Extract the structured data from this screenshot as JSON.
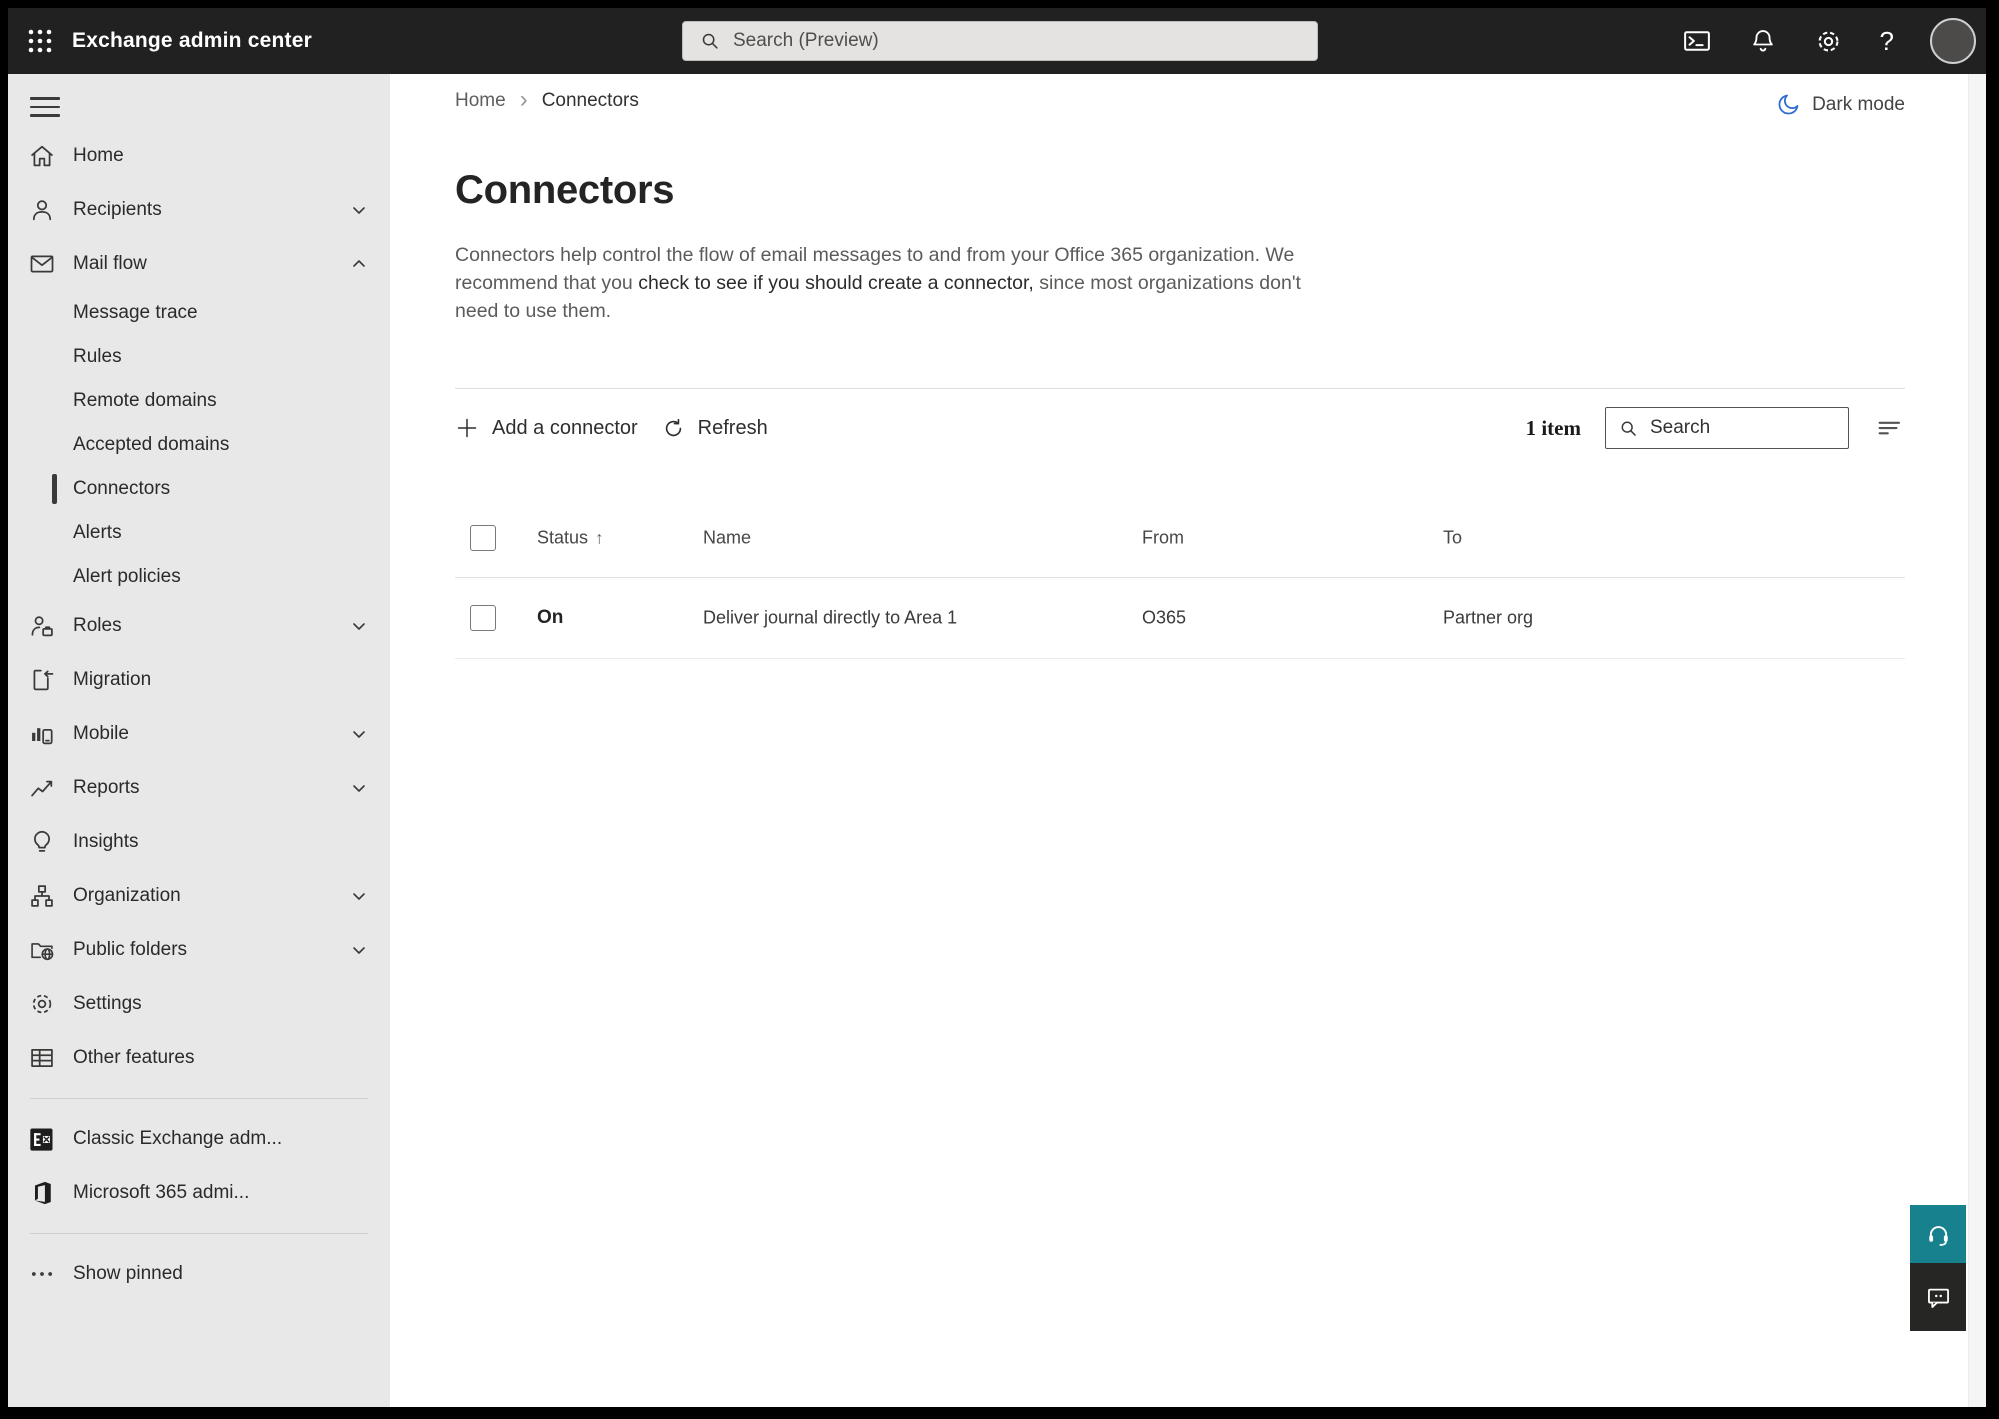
{
  "topbar": {
    "title": "Exchange admin center",
    "search_placeholder": "Search (Preview)",
    "help_glyph": "?"
  },
  "sidebar": {
    "items": [
      {
        "label": "Home"
      },
      {
        "label": "Recipients",
        "chevron": "down"
      },
      {
        "label": "Mail flow",
        "chevron": "up"
      },
      {
        "label": "Message trace",
        "sub": true
      },
      {
        "label": "Rules",
        "sub": true
      },
      {
        "label": "Remote domains",
        "sub": true
      },
      {
        "label": "Accepted domains",
        "sub": true
      },
      {
        "label": "Connectors",
        "sub": true,
        "selected": true
      },
      {
        "label": "Alerts",
        "sub": true
      },
      {
        "label": "Alert policies",
        "sub": true
      },
      {
        "label": "Roles",
        "chevron": "down"
      },
      {
        "label": "Migration"
      },
      {
        "label": "Mobile",
        "chevron": "down"
      },
      {
        "label": "Reports",
        "chevron": "down"
      },
      {
        "label": "Insights"
      },
      {
        "label": "Organization",
        "chevron": "down"
      },
      {
        "label": "Public folders",
        "chevron": "down"
      },
      {
        "label": "Settings"
      },
      {
        "label": "Other features"
      },
      {
        "label": "Classic Exchange adm..."
      },
      {
        "label": "Microsoft 365 admi..."
      },
      {
        "label": "Show pinned"
      }
    ]
  },
  "header": {
    "breadcrumb_home": "Home",
    "breadcrumb_current": "Connectors",
    "dark_mode_label": "Dark mode"
  },
  "page": {
    "title": "Connectors",
    "description_pre": "Connectors help control the flow of email messages to and from your Office 365 organization. We recommend that you ",
    "description_link": "check to see if you should create a connector,",
    "description_post": " since most organizations don't need to use them."
  },
  "toolbar": {
    "add_label": "Add a connector",
    "refresh_label": "Refresh",
    "item_count": "1 item",
    "search_placeholder": "Search"
  },
  "table": {
    "headers": [
      "Status",
      "Name",
      "From",
      "To"
    ],
    "sort_arrow": "↑",
    "rows": [
      {
        "status": "On",
        "name": "Deliver journal directly to Area 1",
        "from": "O365",
        "to": "Partner org"
      }
    ]
  },
  "colors": {
    "topbar_bg": "#212121",
    "sidebar_bg": "#e9e8e8",
    "selected_indicator": "#3b3a39",
    "moon_blue": "#2b6bd4",
    "help_teal": "#17818e",
    "feedback_dark": "#262625"
  }
}
